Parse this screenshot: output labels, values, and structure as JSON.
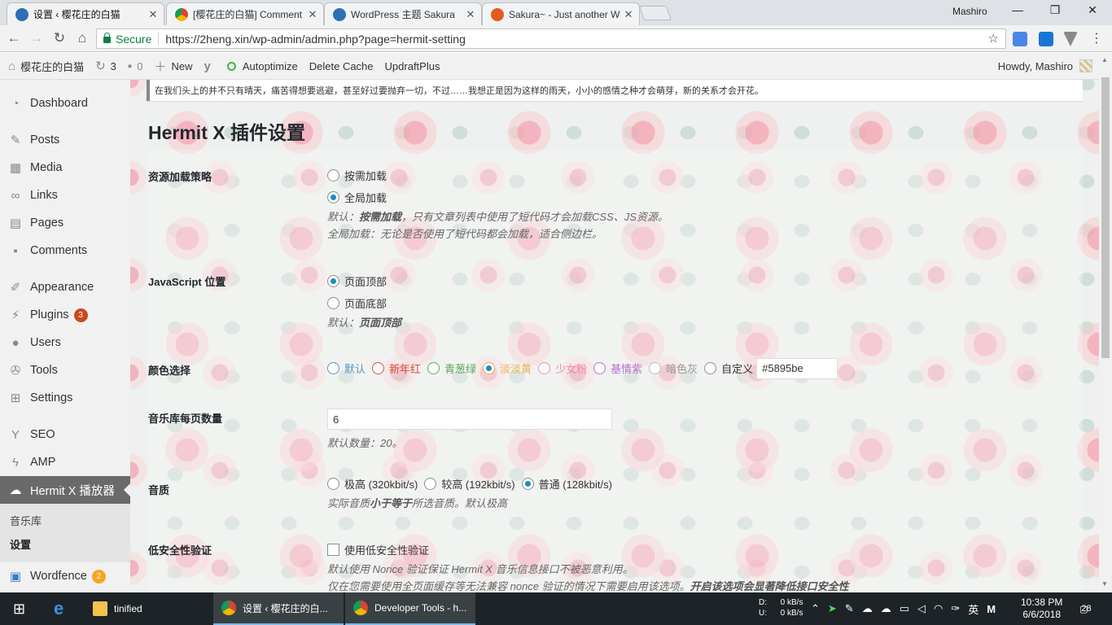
{
  "browser": {
    "tabs": [
      {
        "title": "设置 ‹ 樱花庄的白猫",
        "color": "#2d6fb5"
      },
      {
        "title": "[樱花庄的白猫] Comment",
        "color": "#e8a13a"
      },
      {
        "title": "WordPress 主题 Sakura",
        "color": "#2d6fb5"
      },
      {
        "title": "Sakura~ - Just another W",
        "color": "#e45a1e"
      }
    ],
    "user": "Mashiro",
    "secure_label": "Secure",
    "url": "https://2heng.xin/wp-admin/admin.php?page=hermit-setting"
  },
  "adminbar": {
    "site": "樱花庄的白猫",
    "updates": "3",
    "comments": "0",
    "new": "New",
    "autoptimize": "Autoptimize",
    "delete_cache": "Delete Cache",
    "updraft": "UpdraftPlus",
    "howdy": "Howdy, Mashiro"
  },
  "sidebar": {
    "items": [
      {
        "label": "Dashboard",
        "icon": "dashboard-icon"
      },
      {
        "label": "Posts",
        "icon": "pin-icon"
      },
      {
        "label": "Media",
        "icon": "media-icon"
      },
      {
        "label": "Links",
        "icon": "link-icon"
      },
      {
        "label": "Pages",
        "icon": "pages-icon"
      },
      {
        "label": "Comments",
        "icon": "comment-icon"
      },
      {
        "label": "Appearance",
        "icon": "brush-icon"
      },
      {
        "label": "Plugins",
        "icon": "plugin-icon",
        "badge": "3"
      },
      {
        "label": "Users",
        "icon": "user-icon"
      },
      {
        "label": "Tools",
        "icon": "wrench-icon"
      },
      {
        "label": "Settings",
        "icon": "settings-icon"
      },
      {
        "label": "SEO",
        "icon": "seo-icon"
      },
      {
        "label": "AMP",
        "icon": "amp-icon"
      },
      {
        "label": "Hermit X 播放器",
        "icon": "cloud-icon"
      },
      {
        "label": "Wordfence",
        "icon": "wordfence-icon",
        "badge": "2"
      }
    ],
    "submenu": [
      "音乐库",
      "设置"
    ]
  },
  "content": {
    "notice": "在我们头上的并不只有晴天，痛苦得想要逃避，甚至好过要抛弃一切，不过……我想正是因为这样的雨天，小小的感情之种才会萌芽，新的关系才会开花。",
    "title": "Hermit X 插件设置",
    "loading": {
      "label": "资源加载策略",
      "opt1": "按需加载",
      "opt2": "全局加载",
      "desc1_pre": "默认：",
      "desc1_bold": "按需加载",
      "desc1_post": "，只有文章列表中使用了短代码才会加载CSS、JS资源。",
      "desc2": "全局加载：无论是否使用了短代码都会加载，适合侧边栏。"
    },
    "js": {
      "label": "JavaScript 位置",
      "opt1": "页面顶部",
      "opt2": "页面底部",
      "desc_pre": "默认：",
      "desc_bold": "页面顶部"
    },
    "color": {
      "label": "颜色选择",
      "options": [
        {
          "label": "默认",
          "color": "#5895be"
        },
        {
          "label": "新年红",
          "color": "#dd4b39"
        },
        {
          "label": "青葱绿",
          "color": "#5ca85c"
        },
        {
          "label": "淡淡黄",
          "color": "#f0ad4e"
        },
        {
          "label": "少女粉",
          "color": "#f489a8"
        },
        {
          "label": "基情紫",
          "color": "#b96ed0"
        },
        {
          "label": "暗色灰",
          "color": "#999999"
        },
        {
          "label": "自定义",
          "color": "#333333"
        }
      ],
      "custom_value": "#5895be"
    },
    "music": {
      "label": "音乐库每页数量",
      "value": "6",
      "desc": "默认数量：20。"
    },
    "quality": {
      "label": "音质",
      "opt1": "极高 (320kbit/s)",
      "opt2": "较高 (192kbit/s)",
      "opt3": "普通 (128kbit/s)",
      "desc_pre": "实际音质",
      "desc_bold": "小于等于",
      "desc_post": "所选音质。默认极高"
    },
    "security": {
      "label": "低安全性验证",
      "checkbox": "使用低安全性验证",
      "desc1": "默认使用 Nonce 验证保证 Hermit X 音乐信息接口不被恶意利用。",
      "desc2_pre": "仅在您需要使用全页面缓存等无法兼容 nonce 验证的情况下需要启用该选项。",
      "desc2_bold": "开启该选项会显著降低接口安全性"
    }
  },
  "taskbar": {
    "items": [
      "tinified",
      "设置 ‹ 樱花庄的白...",
      "Developer Tools - h..."
    ],
    "net_down_label": "D:",
    "net_down": "0 kB/s",
    "net_up_label": "U:",
    "net_up": "0 kB/s",
    "ime": "英",
    "time": "10:38 PM",
    "date": "6/6/2018",
    "notifications": "28"
  }
}
